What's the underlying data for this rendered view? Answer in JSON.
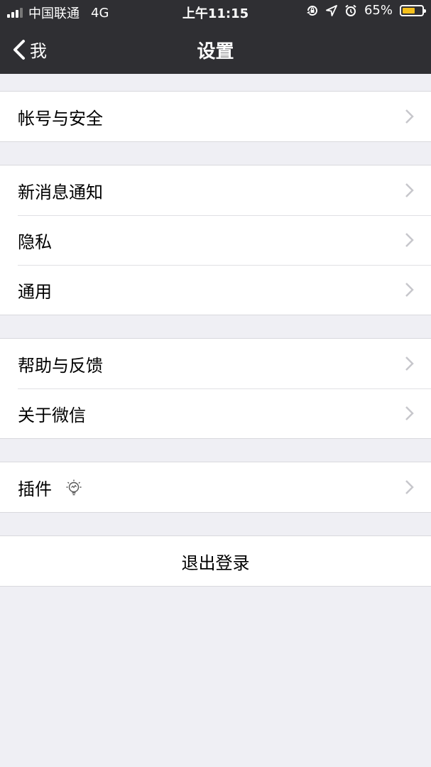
{
  "status_bar": {
    "carrier": "中国联通",
    "network": "4G",
    "time": "上午11:15",
    "battery_percent": "65%",
    "battery_level": 0.65,
    "battery_color": "#f5c01c",
    "icons": [
      "rotation-lock-icon",
      "location-icon",
      "alarm-icon"
    ]
  },
  "nav": {
    "back_label": "我",
    "title": "设置"
  },
  "groups": [
    {
      "items": [
        {
          "label": "帐号与安全"
        }
      ]
    },
    {
      "items": [
        {
          "label": "新消息通知"
        },
        {
          "label": "隐私"
        },
        {
          "label": "通用"
        }
      ]
    },
    {
      "items": [
        {
          "label": "帮助与反馈"
        },
        {
          "label": "关于微信"
        }
      ]
    },
    {
      "items": [
        {
          "label": "插件",
          "icon": "lightbulb-icon"
        }
      ]
    }
  ],
  "logout": {
    "label": "退出登录"
  },
  "colors": {
    "nav_bg": "#2f2f33",
    "page_bg": "#efeff4"
  }
}
